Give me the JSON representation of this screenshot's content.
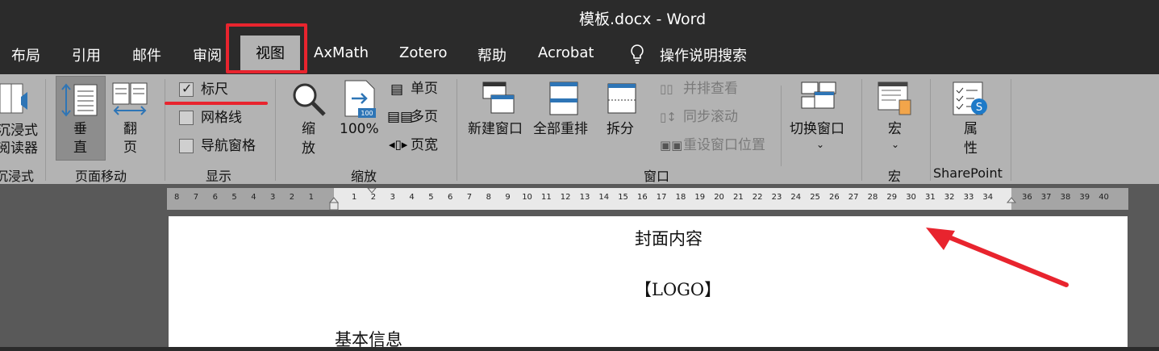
{
  "window": {
    "title": "模板.docx  -  Word"
  },
  "tabs": [
    {
      "label": "布局"
    },
    {
      "label": "引用"
    },
    {
      "label": "邮件"
    },
    {
      "label": "审阅"
    },
    {
      "label": "视图"
    },
    {
      "label": "AxMath"
    },
    {
      "label": "Zotero"
    },
    {
      "label": "帮助"
    },
    {
      "label": "Acrobat"
    },
    {
      "label": "操作说明搜索"
    }
  ],
  "ribbon": {
    "immersive": {
      "btn_line1": "沉浸式",
      "btn_line2": "阅读器",
      "group": "沉浸式"
    },
    "page_move": {
      "vertical_1": "垂",
      "vertical_2": "直",
      "side_1": "翻",
      "side_2": "页",
      "group": "页面移动"
    },
    "show": {
      "ruler": "标尺",
      "gridlines": "网格线",
      "nav_pane": "导航窗格",
      "group": "显示",
      "ruler_checked": true
    },
    "zoom": {
      "zoom_1": "缩",
      "zoom_2": "放",
      "percent": "100%",
      "one_page": "单页",
      "multi_page": "多页",
      "page_width": "页宽",
      "group": "缩放"
    },
    "window": {
      "new_window": "新建窗口",
      "arrange_all": "全部重排",
      "split": "拆分",
      "side_by_side": "并排查看",
      "sync_scroll": "同步滚动",
      "reset_pos": "重设窗口位置",
      "switch_windows": "切换窗口",
      "group": "窗口"
    },
    "macros": {
      "label": "宏",
      "group": "宏"
    },
    "sharepoint": {
      "prop_1": "属",
      "prop_2": "性",
      "group": "SharePoint"
    }
  },
  "ruler": {
    "left_nums": [
      "8",
      "7",
      "6",
      "5",
      "4",
      "3",
      "2",
      "1"
    ],
    "mid_nums": [
      "1",
      "2",
      "3",
      "4",
      "5",
      "6",
      "7",
      "8",
      "9",
      "10",
      "11",
      "12",
      "13",
      "14",
      "15",
      "16",
      "17",
      "18",
      "19",
      "20",
      "21",
      "22",
      "23",
      "24",
      "25",
      "26",
      "27",
      "28",
      "29",
      "30",
      "31",
      "32",
      "33",
      "34"
    ],
    "right_nums": [
      "36",
      "37",
      "38",
      "39",
      "40"
    ]
  },
  "document": {
    "line1": "封面内容",
    "line2": "【LOGO】",
    "line3": "基本信息"
  },
  "colors": {
    "annotation": "#e8242e",
    "ribbon_bg": "#b3b3b3",
    "titlebar_bg": "#2b2b2b"
  }
}
